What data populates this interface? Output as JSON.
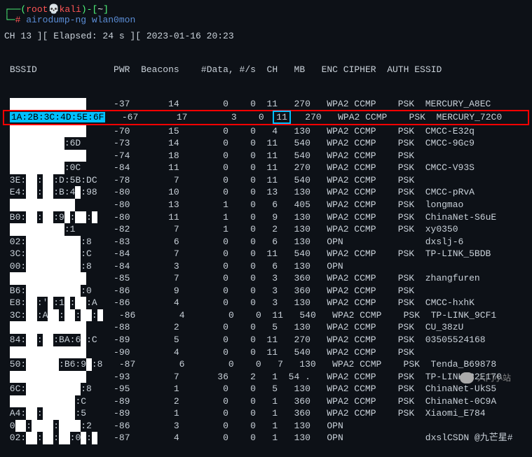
{
  "prompt": {
    "open_paren": "┌──(",
    "user": "root",
    "skull": "💀",
    "host": "kali",
    "close_paren": ")-[",
    "path": "~",
    "end_bracket": "]",
    "second_line_prefix": "└─",
    "hash": "#",
    "command": "airodump-ng wlan0mon"
  },
  "status": "CH 13 ][ Elapsed: 24 s ][ 2023-01-16 20:23",
  "headers": {
    "bssid": "BSSID",
    "pwr": "PWR",
    "beacons": "Beacons",
    "data": "#Data,",
    "per_s": "#/s",
    "ch": "CH",
    "mb": "MB",
    "enc": "ENC",
    "cipher": "CIPHER",
    "auth": "AUTH",
    "essid": "ESSID"
  },
  "rows": [
    {
      "bssid": "██████████████",
      "pwr": "-37",
      "beacons": "14",
      "data": "0",
      "ps": "0",
      "ch": "11",
      "mb": "270",
      "enc": "WPA2",
      "cipher": "CCMP",
      "auth": "PSK",
      "essid": "MERCURY_A8EC"
    },
    {
      "bssid": "1A:2B:3C:4D:5E:6F",
      "pwr": "-67",
      "beacons": "17",
      "data": "3",
      "ps": "0",
      "ch": "11",
      "mb": "270",
      "enc": "WPA2",
      "cipher": "CCMP",
      "auth": "PSK",
      "essid": "MERCURY_72C0",
      "highlight": true
    },
    {
      "bssid": "██████████████",
      "pwr": "-70",
      "beacons": "15",
      "data": "0",
      "ps": "0",
      "ch": "4",
      "mb": "130",
      "enc": "WPA2",
      "cipher": "CCMP",
      "auth": "PSK",
      "essid": "CMCC-E32q"
    },
    {
      "bssid": "██████████:6D",
      "pwr": "-73",
      "beacons": "14",
      "data": "0",
      "ps": "0",
      "ch": "11",
      "mb": "540",
      "enc": "WPA2",
      "cipher": "CCMP",
      "auth": "PSK",
      "essid": "CMCC-9Gc9"
    },
    {
      "bssid": "██████████████",
      "pwr": "-74",
      "beacons": "18",
      "data": "0",
      "ps": "0",
      "ch": "11",
      "mb": "540",
      "enc": "WPA2",
      "cipher": "CCMP",
      "auth": "PSK",
      "essid": "<length:  0>"
    },
    {
      "bssid": "██████████:0C",
      "pwr": "-84",
      "beacons": "11",
      "data": "0",
      "ps": "0",
      "ch": "11",
      "mb": "270",
      "enc": "WPA2",
      "cipher": "CCMP",
      "auth": "PSK",
      "essid": "CMCC-V93S"
    },
    {
      "bssid": "3E:██:██:D:5B:DC",
      "pwr": "-78",
      "beacons": "7",
      "data": "0",
      "ps": "0",
      "ch": "11",
      "mb": "540",
      "enc": "WPA2",
      "cipher": "CCMP",
      "auth": "PSK",
      "essid": "<length:  0>"
    },
    {
      "bssid": "E4:██:██:B:4█:98",
      "pwr": "-80",
      "beacons": "10",
      "data": "0",
      "ps": "0",
      "ch": "13",
      "mb": "130",
      "enc": "WPA2",
      "cipher": "CCMP",
      "auth": "PSK",
      "essid": "CMCC-pRvA"
    },
    {
      "bssid": "████████████",
      "pwr": "-80",
      "beacons": "13",
      "data": "1",
      "ps": "0",
      "ch": "6",
      "mb": "405",
      "enc": "WPA2",
      "cipher": "CCMP",
      "auth": "PSK",
      "essid": "longmao"
    },
    {
      "bssid": "B0:██:██:9█:██:█",
      "pwr": "-80",
      "beacons": "11",
      "data": "1",
      "ps": "0",
      "ch": "9",
      "mb": "130",
      "enc": "WPA2",
      "cipher": "CCMP",
      "auth": "PSK",
      "essid": "ChinaNet-S6uE"
    },
    {
      "bssid": "██████████:1",
      "pwr": "-82",
      "beacons": "7",
      "data": "1",
      "ps": "0",
      "ch": "2",
      "mb": "130",
      "enc": "WPA2",
      "cipher": "CCMP",
      "auth": "PSK",
      "essid": "xy0350"
    },
    {
      "bssid": "02:██████████:8",
      "pwr": "-83",
      "beacons": "6",
      "data": "0",
      "ps": "0",
      "ch": "6",
      "mb": "130",
      "enc": "OPN",
      "cipher": "",
      "auth": "",
      "essid": "dxslj-6"
    },
    {
      "bssid": "3C:██████████:C",
      "pwr": "-84",
      "beacons": "7",
      "data": "0",
      "ps": "0",
      "ch": "11",
      "mb": "540",
      "enc": "WPA2",
      "cipher": "CCMP",
      "auth": "PSK",
      "essid": "TP-LINK_5BDB"
    },
    {
      "bssid": "00:██████████:8",
      "pwr": "-84",
      "beacons": "3",
      "data": "0",
      "ps": "0",
      "ch": "6",
      "mb": "130",
      "enc": "OPN",
      "cipher": "",
      "auth": "",
      "essid": "<length:  0>"
    },
    {
      "bssid": "██████████████",
      "pwr": "-85",
      "beacons": "7",
      "data": "0",
      "ps": "0",
      "ch": "3",
      "mb": "360",
      "enc": "WPA2",
      "cipher": "CCMP",
      "auth": "PSK",
      "essid": "zhangfuren"
    },
    {
      "bssid": "B6:██████████:0",
      "pwr": "-86",
      "beacons": "9",
      "data": "0",
      "ps": "0",
      "ch": "3",
      "mb": "360",
      "enc": "WPA2",
      "cipher": "CCMP",
      "auth": "PSK",
      "essid": "<length:  0>"
    },
    {
      "bssid": "E8:██:'█:1█:██:A",
      "pwr": "-86",
      "beacons": "4",
      "data": "0",
      "ps": "0",
      "ch": "3",
      "mb": "130",
      "enc": "WPA2",
      "cipher": "CCMP",
      "auth": "PSK",
      "essid": "CMCC-hxhK"
    },
    {
      "bssid": "3C:██:A██:██:██:█",
      "pwr": "-86",
      "beacons": "4",
      "data": "0",
      "ps": "0",
      "ch": "11",
      "mb": "540",
      "enc": "WPA2",
      "cipher": "CCMP",
      "auth": "PSK",
      "essid": "TP-LINK_9CF1"
    },
    {
      "bssid": "██████████████",
      "pwr": "-88",
      "beacons": "2",
      "data": "0",
      "ps": "0",
      "ch": "5",
      "mb": "130",
      "enc": "WPA2",
      "cipher": "CCMP",
      "auth": "PSK",
      "essid": "CU_38zU"
    },
    {
      "bssid": "84:██:██:BA:6█:C",
      "pwr": "-89",
      "beacons": "5",
      "data": "0",
      "ps": "0",
      "ch": "11",
      "mb": "270",
      "enc": "WPA2",
      "cipher": "CCMP",
      "auth": "PSK",
      "essid": "03505524168"
    },
    {
      "bssid": "██████████████",
      "pwr": "-90",
      "beacons": "4",
      "data": "0",
      "ps": "0",
      "ch": "11",
      "mb": "540",
      "enc": "WPA2",
      "cipher": "CCMP",
      "auth": "PSK",
      "essid": "<length:  0>"
    },
    {
      "bssid": "50:██████:B6:9█:8",
      "pwr": "-87",
      "beacons": "6",
      "data": "0",
      "ps": "0",
      "ch": "7",
      "mb": "130",
      "enc": "WPA2",
      "cipher": "CCMP",
      "auth": "PSK",
      "essid": "Tenda_B69878"
    },
    {
      "bssid": "██████████████",
      "pwr": "-93",
      "beacons": "7",
      "data": "36",
      "ps": "2",
      "ch": "1",
      "mb": "54 .",
      "enc": "WPA2",
      "cipher": "CCMP",
      "auth": "PSK",
      "essid": "TP-LINK_22E170"
    },
    {
      "bssid": "6C:██████████:8",
      "pwr": "-95",
      "beacons": "1",
      "data": "0",
      "ps": "0",
      "ch": "5",
      "mb": "130",
      "enc": "WPA2",
      "cipher": "CCMP",
      "auth": "PSK",
      "essid": "ChinaNet-UkS5"
    },
    {
      "bssid": "████████████:C",
      "pwr": "-89",
      "beacons": "2",
      "data": "0",
      "ps": "0",
      "ch": "1",
      "mb": "360",
      "enc": "WPA2",
      "cipher": "CCMP",
      "auth": "PSK",
      "essid": "ChinaNet-0C9A"
    },
    {
      "bssid": "A4:██:██████:5",
      "pwr": "-89",
      "beacons": "1",
      "data": "0",
      "ps": "0",
      "ch": "1",
      "mb": "360",
      "enc": "WPA2",
      "cipher": "CCMP",
      "auth": "PSK",
      "essid": "Xiaomi_E784"
    },
    {
      "bssid": "0██:████:████:2",
      "pwr": "-86",
      "beacons": "3",
      "data": "0",
      "ps": "0",
      "ch": "1",
      "mb": "130",
      "enc": "OPN",
      "cipher": "",
      "auth": "",
      "essid": "<length:  0>"
    },
    {
      "bssid": "02:██:██:██:0█:█",
      "pwr": "-87",
      "beacons": "4",
      "data": "0",
      "ps": "0",
      "ch": "1",
      "mb": "130",
      "enc": "OPN",
      "cipher": "",
      "auth": "",
      "essid": "dxslCSDN @九芒星#"
    }
  ],
  "watermark1": "入门小站",
  "watermark2": "CSDN @九芒星#"
}
